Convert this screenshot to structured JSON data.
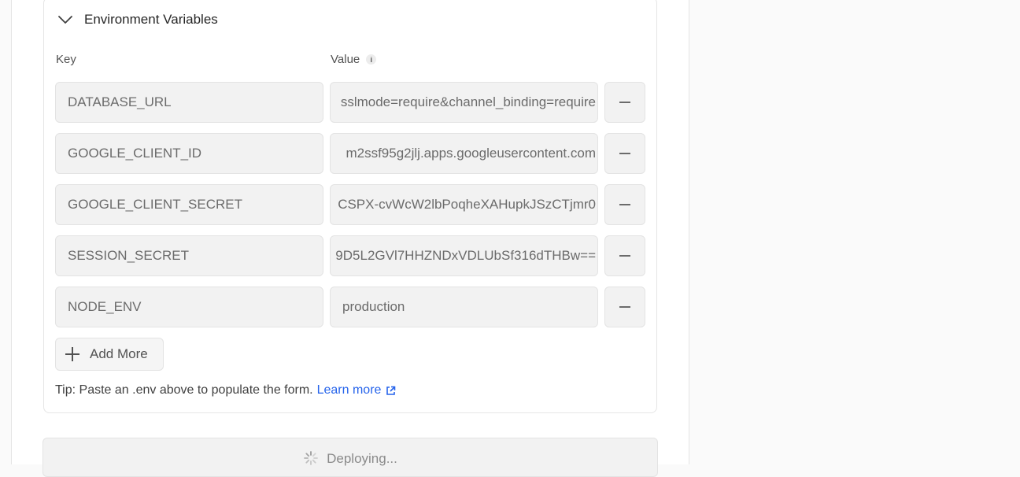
{
  "env_section": {
    "title": "Environment Variables",
    "key_label": "Key",
    "value_label": "Value",
    "rows": [
      {
        "key": "DATABASE_URL",
        "value": "sslmode=require&channel_binding=require"
      },
      {
        "key": "GOOGLE_CLIENT_ID",
        "value": "m2ssf95g2jlj.apps.googleusercontent.com"
      },
      {
        "key": "GOOGLE_CLIENT_SECRET",
        "value": "CSPX-cvWcW2lbPoqheXAHupkJSzCTjmr0"
      },
      {
        "key": "SESSION_SECRET",
        "value": "9D5L2GVl7HHZNDxVDLUbSf316dTHBw=="
      },
      {
        "key": "NODE_ENV",
        "value": "production"
      }
    ],
    "add_more_label": "Add More",
    "tip_text": "Tip: Paste an .env above to populate the form.",
    "learn_more_label": "Learn more"
  },
  "deploy": {
    "label": "Deploying..."
  },
  "icons": {
    "collapse": "chevron-down-icon",
    "info": "info-icon",
    "remove": "minus-icon",
    "add": "plus-icon",
    "external": "external-link-icon",
    "loading": "spinner-icon"
  },
  "colors": {
    "link": "#2563eb",
    "field_bg": "#f2f2f2",
    "border": "#e5e5e5"
  }
}
